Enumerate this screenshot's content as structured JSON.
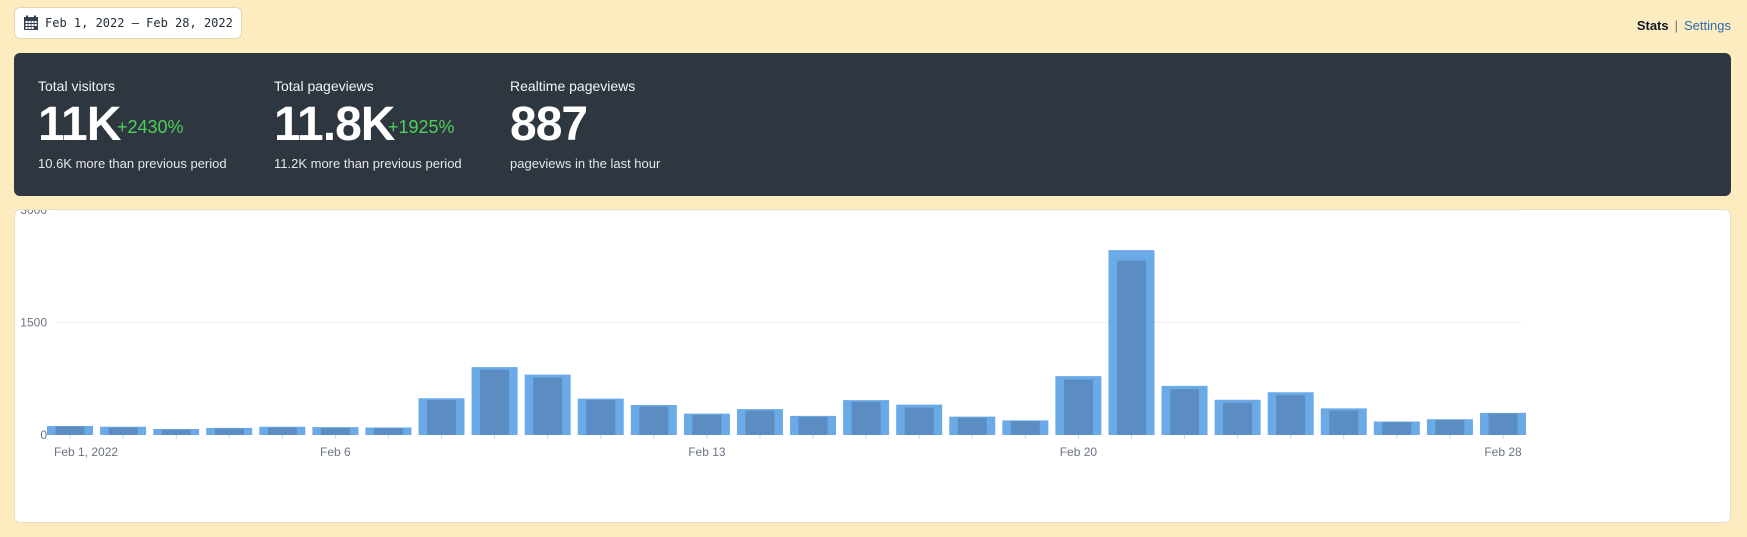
{
  "date_range": {
    "label": "Feb 1, 2022 — Feb 28, 2022",
    "icon": "calendar-icon"
  },
  "nav": {
    "stats": "Stats",
    "separator": "|",
    "settings": "Settings"
  },
  "metrics": {
    "visitors": {
      "label": "Total visitors",
      "value": "11K",
      "change": "+2430%",
      "sub": "10.6K more than previous period"
    },
    "pageviews": {
      "label": "Total pageviews",
      "value": "11.8K",
      "change": "+1925%",
      "sub": "11.2K more than previous period"
    },
    "realtime": {
      "label": "Realtime pageviews",
      "value": "887",
      "sub": "pageviews in the last hour"
    }
  },
  "colors": {
    "background": "#fdecc0",
    "panel": "#2e3640",
    "positive": "#4fd05a",
    "bar_light": "#6aaae6",
    "bar_dark": "#5b8dc2",
    "link": "#2b6cb0"
  },
  "chart_data": {
    "type": "bar",
    "categories": [
      "Feb 1",
      "Feb 2",
      "Feb 3",
      "Feb 4",
      "Feb 5",
      "Feb 6",
      "Feb 7",
      "Feb 8",
      "Feb 9",
      "Feb 10",
      "Feb 11",
      "Feb 12",
      "Feb 13",
      "Feb 14",
      "Feb 15",
      "Feb 16",
      "Feb 17",
      "Feb 18",
      "Feb 19",
      "Feb 20",
      "Feb 21",
      "Feb 22",
      "Feb 23",
      "Feb 24",
      "Feb 25",
      "Feb 26",
      "Feb 27",
      "Feb 28"
    ],
    "series": [
      {
        "values": [
          120,
          110,
          80,
          95,
          110,
          105,
          100,
          490,
          905,
          805,
          485,
          400,
          285,
          345,
          255,
          465,
          405,
          245,
          195,
          785,
          2465,
          655,
          470,
          570,
          355,
          180,
          210,
          295
        ]
      },
      {
        "values": [
          115,
          100,
          70,
          85,
          100,
          95,
          90,
          465,
          870,
          765,
          465,
          380,
          270,
          325,
          240,
          440,
          365,
          230,
          185,
          740,
          2325,
          610,
          430,
          530,
          325,
          170,
          200,
          285
        ]
      }
    ],
    "x_tick_labels": [
      "Feb 1, 2022",
      "Feb 6",
      "Feb 13",
      "Feb 20",
      "Feb 28"
    ],
    "x_tick_indices": [
      0,
      5,
      12,
      19,
      27
    ],
    "y_ticks": [
      0,
      1500,
      3000
    ],
    "ylim": [
      0,
      3000
    ],
    "grid": true
  }
}
